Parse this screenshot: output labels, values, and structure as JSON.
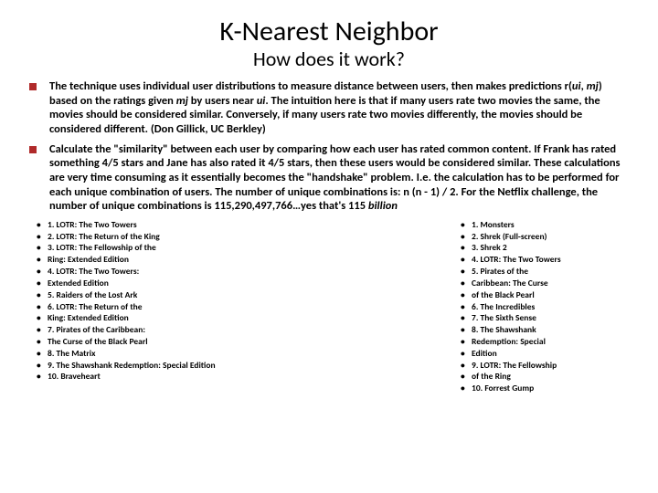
{
  "title": "K-Nearest Neighbor",
  "subtitle": "How does it work?",
  "bullets": [
    {
      "pre": "The technique uses individual user distributions to measure distance between users, then makes predictions r(",
      "i1": "ui",
      "mid1": ", ",
      "i2": "mj",
      "mid2": ") based on the ratings given ",
      "i3": "mj",
      "mid3": " by users near ",
      "i4": "ui",
      "post": ". The intuition here is that if many users rate two movies the same, the movies should be considered similar. Conversely, if many users rate two movies differently, the movies should be considered different. (Don Gillick, UC Berkley)"
    },
    {
      "text1": "Calculate the \"similarity\" between each user by comparing how each user has rated common content. If Frank has rated something 4/5 stars and Jane has also rated it 4/5 stars, then these users would be considered similar. These calculations are very time consuming as it essentially becomes the \"handshake\" problem. I.e. the calculation has to be performed for each unique combination of users. The number of unique combinations is: n (n - 1) / 2. For the Netflix challenge, the number of unique combinations is 115,290,497,766…yes that's 115 ",
      "i1": "billion"
    }
  ],
  "left_list": [
    "1. LOTR: The Two Towers",
    "2. LOTR: The Return of the King",
    "3. LOTR: The Fellowship of the",
    "Ring: Extended Edition",
    "4. LOTR: The Two Towers:",
    "Extended Edition",
    "5. Raiders of the Lost Ark",
    "6. LOTR: The Return of the",
    "King: Extended Edition",
    "7. Pirates of the Caribbean:",
    "The Curse of the Black Pearl",
    "8. The Matrix",
    "9. The Shawshank Redemption: Special Edition",
    "10. Braveheart"
  ],
  "right_list": [
    "1. Monsters",
    "2. Shrek (Full-screen)",
    "3. Shrek 2",
    "4. LOTR: The Two Towers",
    "5. Pirates of the",
    "Caribbean: The Curse",
    "of the Black Pearl",
    "6. The Incredibles",
    "7. The Sixth Sense",
    "8. The Shawshank",
    "Redemption: Special",
    "Edition",
    "9. LOTR: The Fellowship",
    "of the Ring",
    "10. Forrest Gump"
  ]
}
